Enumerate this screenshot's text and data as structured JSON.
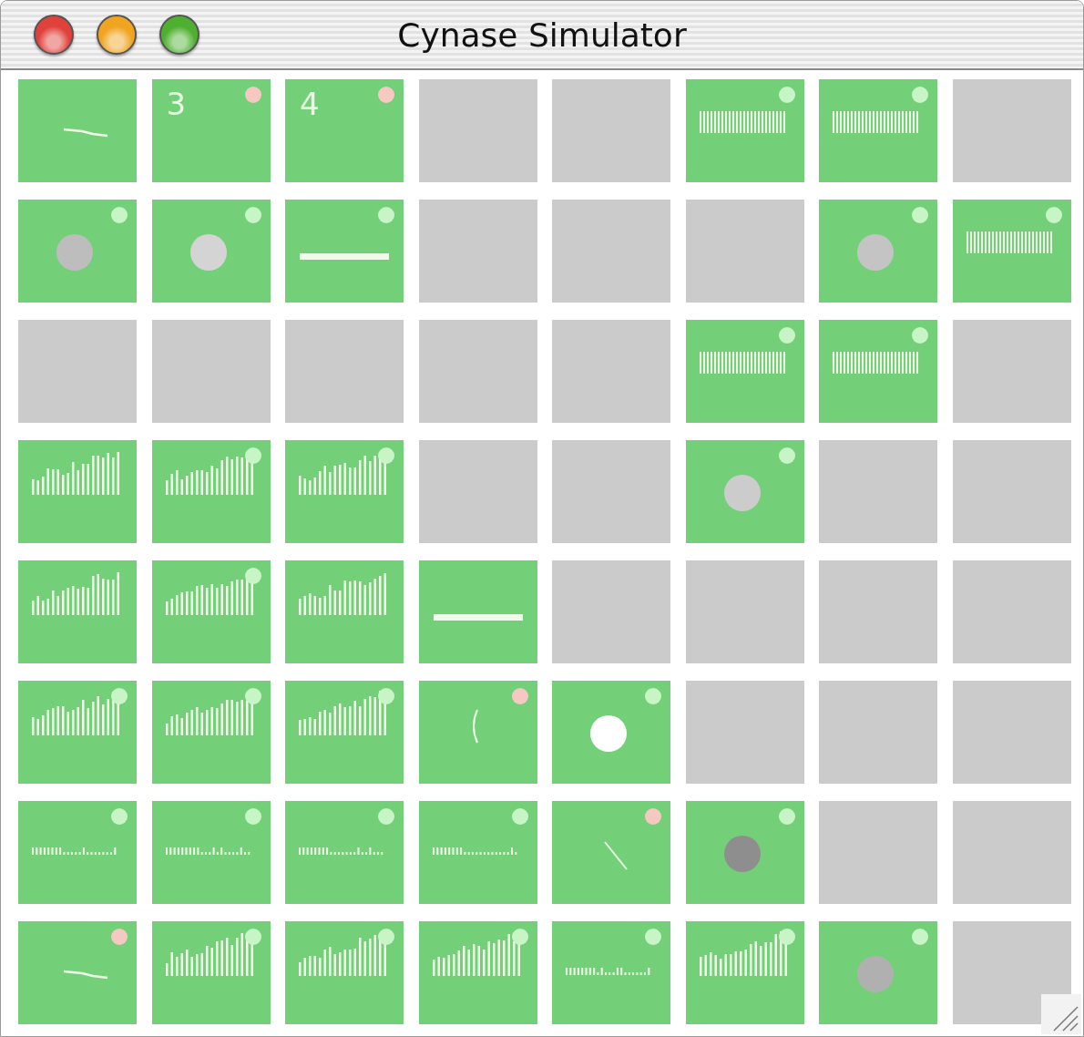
{
  "window": {
    "title": "Cynase Simulator"
  },
  "grid": {
    "rows": [
      {
        "cells": [
          {
            "kind": "line",
            "lamp": false
          },
          {
            "kind": "number",
            "number": "3",
            "lamp": true,
            "alert": true
          },
          {
            "kind": "number",
            "number": "4",
            "lamp": true,
            "alert": true
          },
          {
            "kind": "empty"
          },
          {
            "kind": "empty"
          },
          {
            "kind": "comb",
            "lamp": true,
            "alert": false
          },
          {
            "kind": "comb",
            "lamp": true,
            "alert": false
          },
          {
            "kind": "empty"
          }
        ]
      },
      {
        "cells": [
          {
            "kind": "ball",
            "color": "#bdbdbd",
            "lamp": true,
            "alert": false
          },
          {
            "kind": "ball",
            "color": "#d4d4d4",
            "lamp": true,
            "alert": false
          },
          {
            "kind": "dash",
            "lamp": true,
            "alert": false
          },
          {
            "kind": "empty"
          },
          {
            "kind": "empty"
          },
          {
            "kind": "empty"
          },
          {
            "kind": "ball",
            "color": "#c4c4c4",
            "lamp": true,
            "alert": false
          },
          {
            "kind": "comb",
            "lamp": true,
            "alert": false
          }
        ]
      },
      {
        "cells": [
          {
            "kind": "empty"
          },
          {
            "kind": "empty"
          },
          {
            "kind": "empty"
          },
          {
            "kind": "empty"
          },
          {
            "kind": "empty"
          },
          {
            "kind": "comb",
            "lamp": true,
            "alert": false
          },
          {
            "kind": "comb",
            "lamp": true,
            "alert": false
          },
          {
            "kind": "empty"
          }
        ]
      },
      {
        "cells": [
          {
            "kind": "bars",
            "lamp": false
          },
          {
            "kind": "bars",
            "lamp": true,
            "alert": false
          },
          {
            "kind": "bars",
            "lamp": true,
            "alert": false
          },
          {
            "kind": "empty"
          },
          {
            "kind": "empty"
          },
          {
            "kind": "ball",
            "color": "#cccccc",
            "lamp": true,
            "alert": false
          },
          {
            "kind": "empty"
          },
          {
            "kind": "empty"
          }
        ]
      },
      {
        "cells": [
          {
            "kind": "bars",
            "lamp": false
          },
          {
            "kind": "bars",
            "lamp": true,
            "alert": false
          },
          {
            "kind": "bars",
            "lamp": false
          },
          {
            "kind": "dash",
            "lamp": false
          },
          {
            "kind": "empty"
          },
          {
            "kind": "empty"
          },
          {
            "kind": "empty"
          },
          {
            "kind": "empty"
          }
        ]
      },
      {
        "cells": [
          {
            "kind": "bars",
            "lamp": true,
            "alert": false
          },
          {
            "kind": "bars",
            "lamp": true,
            "alert": false
          },
          {
            "kind": "bars",
            "lamp": true,
            "alert": false
          },
          {
            "kind": "arc",
            "lamp": true,
            "alert": true
          },
          {
            "kind": "ball",
            "color": "#ffffff",
            "lamp": true,
            "alert": false
          },
          {
            "kind": "empty"
          },
          {
            "kind": "empty"
          },
          {
            "kind": "empty"
          }
        ]
      },
      {
        "cells": [
          {
            "kind": "dots",
            "lamp": true,
            "alert": false
          },
          {
            "kind": "dots",
            "lamp": true,
            "alert": false
          },
          {
            "kind": "dots",
            "lamp": true,
            "alert": false
          },
          {
            "kind": "dots",
            "lamp": true,
            "alert": false
          },
          {
            "kind": "slash",
            "lamp": true,
            "alert": true
          },
          {
            "kind": "ball",
            "color": "#8e8e8e",
            "lamp": true,
            "alert": false
          },
          {
            "kind": "empty"
          },
          {
            "kind": "empty"
          }
        ]
      },
      {
        "cells": [
          {
            "kind": "line",
            "lamp": true,
            "alert": true
          },
          {
            "kind": "bars",
            "lamp": true,
            "alert": false
          },
          {
            "kind": "bars",
            "lamp": true,
            "alert": false
          },
          {
            "kind": "bars",
            "lamp": true,
            "alert": false
          },
          {
            "kind": "dots",
            "lamp": true,
            "alert": false
          },
          {
            "kind": "bars",
            "lamp": true,
            "alert": false
          },
          {
            "kind": "ball",
            "color": "#b0b0b0",
            "lamp": true,
            "alert": false
          },
          {
            "kind": "empty"
          }
        ]
      }
    ]
  }
}
